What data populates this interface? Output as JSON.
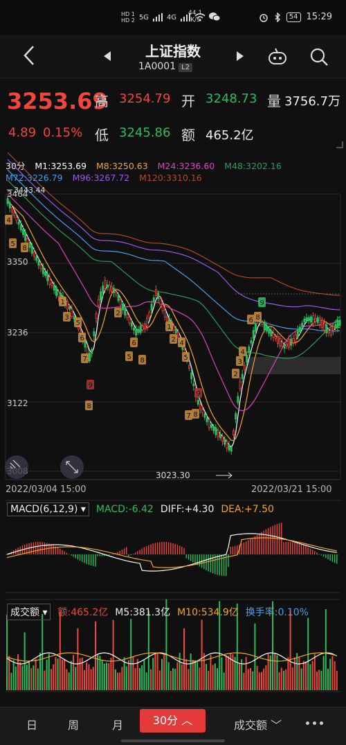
{
  "status_bar": {
    "signal_1": "HD 1",
    "signal_2": "HD 2",
    "net_5g": "5G",
    "net_4g": "4G",
    "speed_value": "44.1",
    "speed_unit": "K/s",
    "battery": "54",
    "time": "15:29"
  },
  "header": {
    "title": "上证指数",
    "code": "1A0001",
    "badge": "L2"
  },
  "quote": {
    "price": "3253.69",
    "change": "4.89",
    "change_pct": "0.15%",
    "high_label": "高",
    "high": "3254.79",
    "open_label": "开",
    "open": "3248.73",
    "volume_label": "量",
    "volume": "3756.7万",
    "low_label": "低",
    "low": "3245.86",
    "amount_label": "额",
    "amount": "465.2亿"
  },
  "ma_legend": {
    "period": "30分",
    "m1": "M1:3253.69",
    "m8": "M8:3250.63",
    "m24": "M24:3236.60",
    "m48": "M48:3202.16",
    "m72": "M72:3226.79",
    "m96": "M96:3267.72",
    "m120": "M120:3310.16"
  },
  "colors": {
    "up": "#f0463c",
    "down": "#2bbd5e",
    "m1": "#ffffff",
    "m8": "#f5a623",
    "m24": "#e040c0",
    "m48": "#2e9a5a",
    "m72": "#4a9fe8",
    "m96": "#9b59f0",
    "m120": "#b0482a"
  },
  "price_axis": {
    "top_label": "3464",
    "max_marker": "3443.44",
    "ticks": [
      "3350",
      "3236",
      "3122",
      "3008"
    ],
    "min_marker": "3023.30"
  },
  "date_axis": {
    "start": "2022/03/04 15:00",
    "end": "2022/03/21 15:00"
  },
  "macd": {
    "selector": "MACD(6,12,9)",
    "macd": "MACD:-6.42",
    "diff": "DIFF:+4.30",
    "dea": "DEA:+7.50"
  },
  "volume_panel": {
    "selector": "成交额",
    "amount": "额:465.2亿",
    "m5": "M5:381.3亿",
    "m10": "M10:534.9亿",
    "turnover": "换手率:0.10%"
  },
  "bottom_tabs": {
    "day": "日",
    "week": "周",
    "month": "月",
    "active": "30分",
    "indicator": "成交额"
  }
}
